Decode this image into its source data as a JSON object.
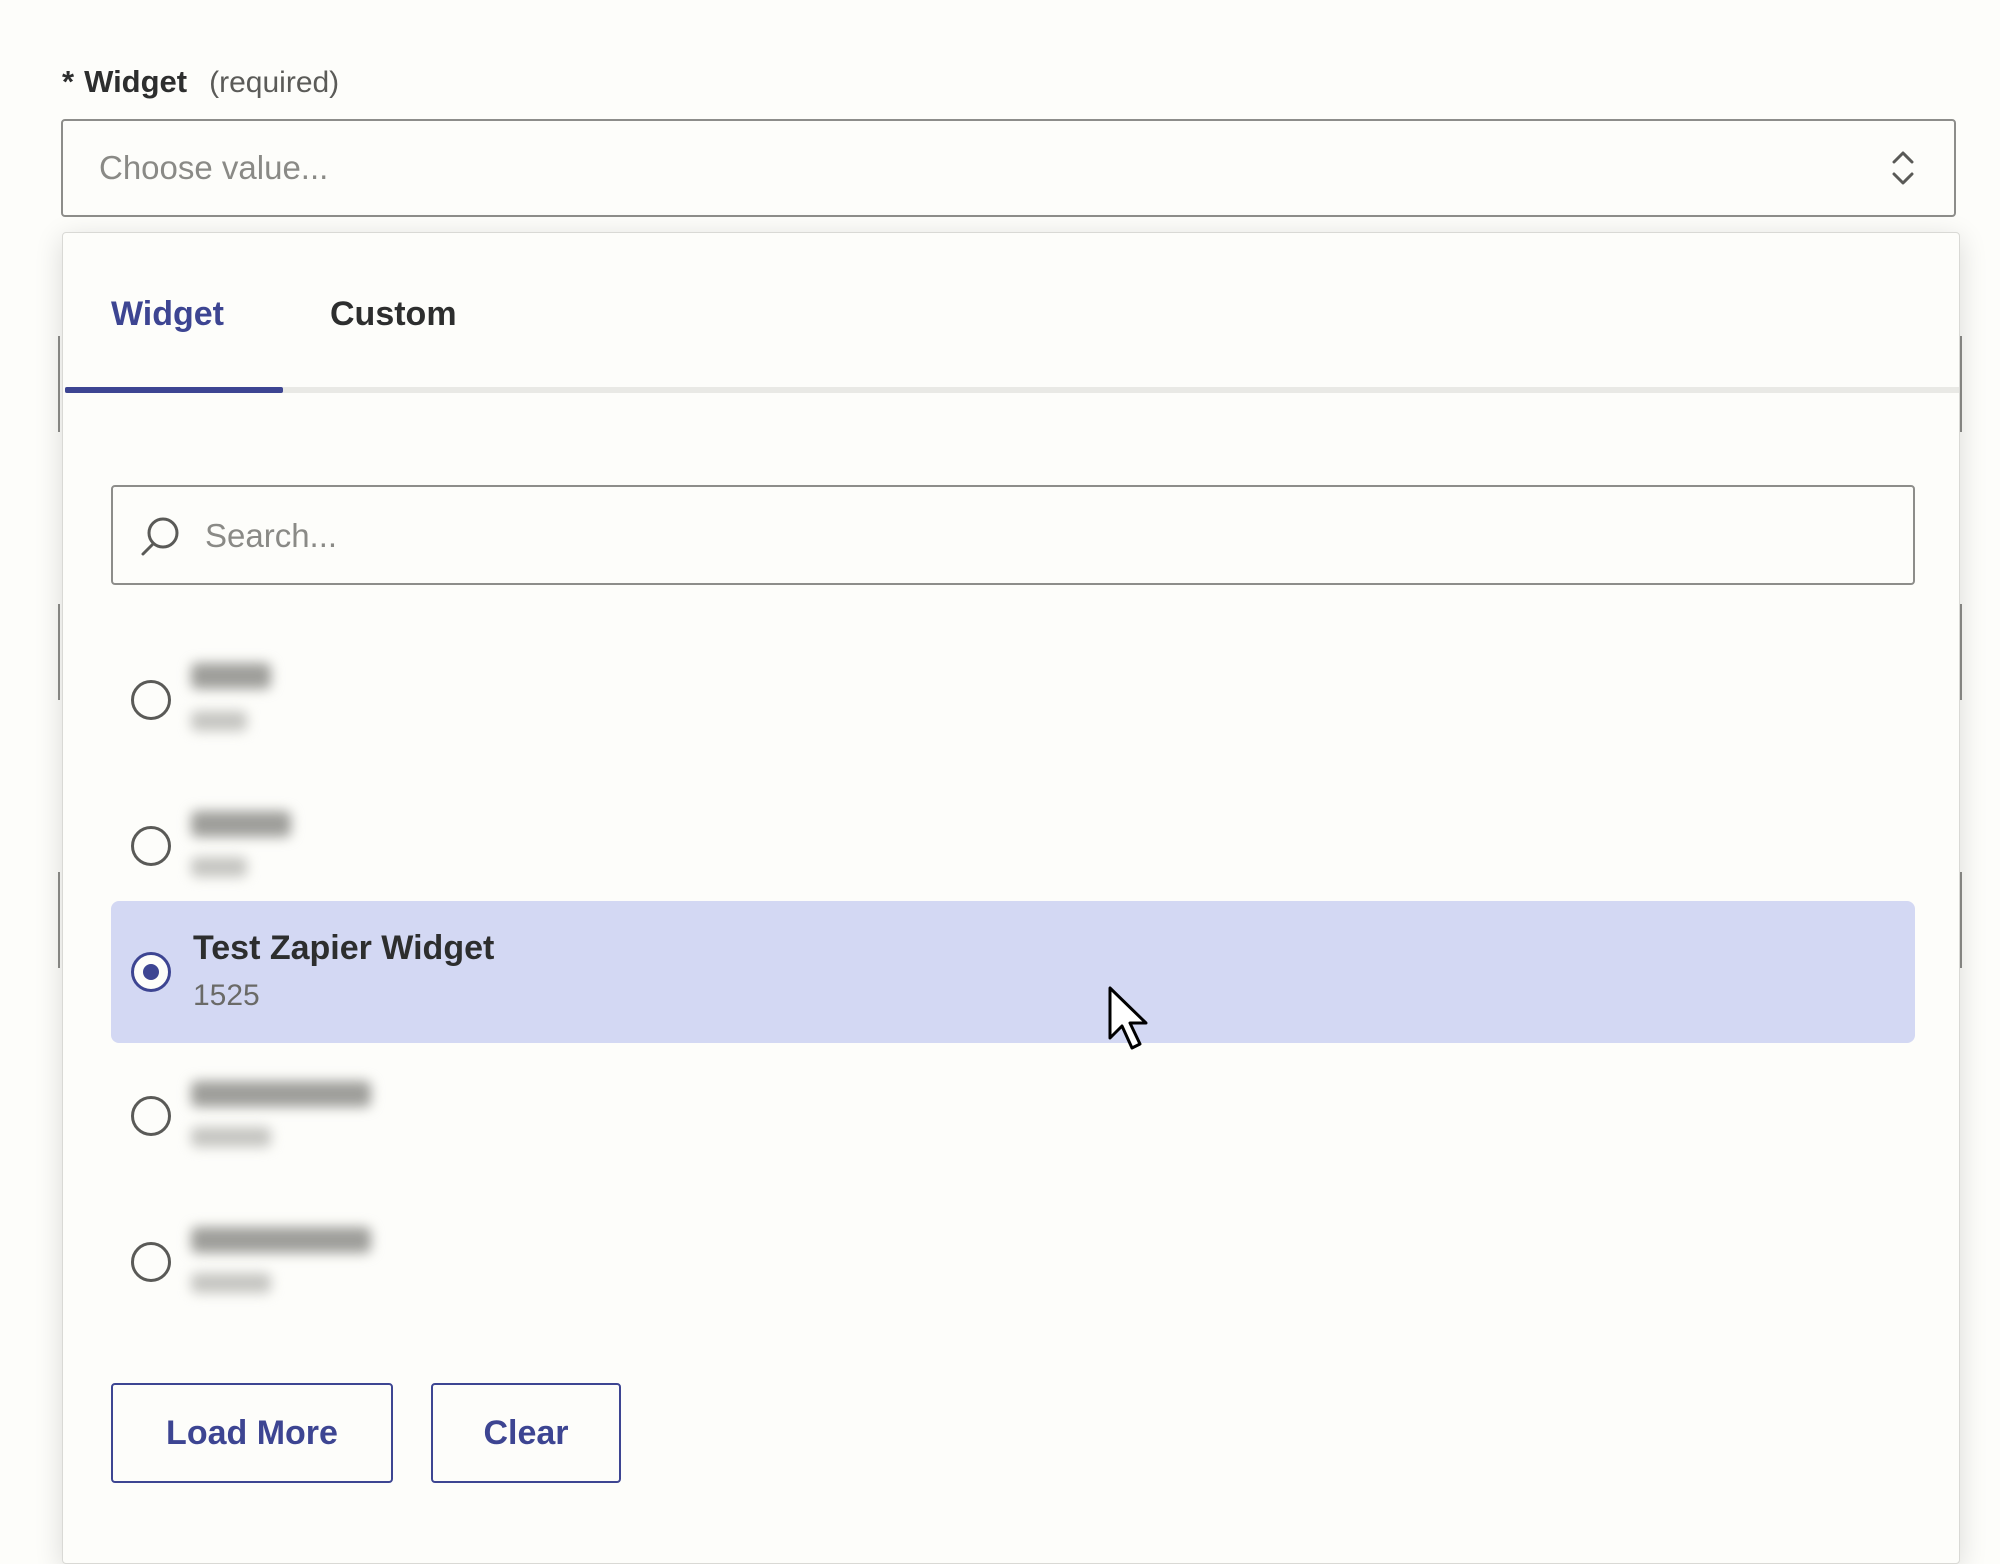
{
  "field": {
    "required_marker": "*",
    "label": "Widget",
    "required_text": "(required)",
    "placeholder": "Choose value..."
  },
  "dropdown": {
    "tabs": [
      {
        "label": "Widget",
        "active": true
      },
      {
        "label": "Custom",
        "active": false
      }
    ],
    "search_placeholder": "Search...",
    "options": [
      {
        "selected": false,
        "blurred": true
      },
      {
        "selected": false,
        "blurred": true
      },
      {
        "title": "Test Zapier Widget",
        "subtitle": "1525",
        "selected": true,
        "blurred": false
      },
      {
        "selected": false,
        "blurred": true
      },
      {
        "selected": false,
        "blurred": true
      }
    ],
    "load_more_label": "Load More",
    "clear_label": "Clear"
  },
  "colors": {
    "accent": "#3d4592",
    "selected_bg": "#d3d8f3",
    "page_bg": "#fdfdfa"
  },
  "icons": [
    "chevron-up-down-icon",
    "search-icon",
    "mouse-cursor-icon"
  ]
}
